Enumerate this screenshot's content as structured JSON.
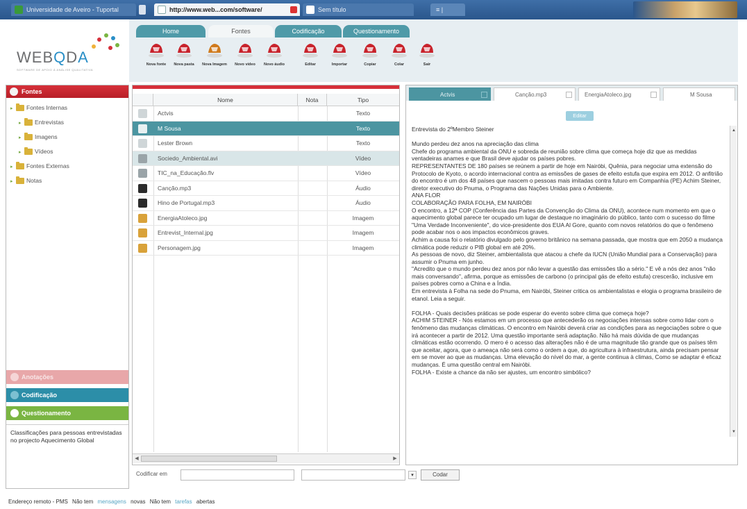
{
  "browser": {
    "tabs": [
      "Universidade de Aveiro - Tuportal",
      "http://www.web...com/software/",
      "Sem título"
    ],
    "extra_tab": "≡ |"
  },
  "logo": {
    "text_prefix": "WEB",
    "text_q": "Q",
    "text_d": "D",
    "text_a": "A",
    "subtitle": "SOFTWARE DE APOIO À ANÁLISE QUALITATIVA"
  },
  "main_tabs": [
    "Home",
    "Fontes",
    "Codificação",
    "Questionamento"
  ],
  "toolbar": [
    {
      "label": "Nova fonte",
      "color": "#c8232c"
    },
    {
      "label": "Nova pasta",
      "color": "#c8232c"
    },
    {
      "label": "Nova Imagem",
      "color": "#d07a1c"
    },
    {
      "label": "Novo vídeo",
      "color": "#c8232c"
    },
    {
      "label": "Novo áudio",
      "color": "#c8232c"
    },
    {
      "label": "Editar",
      "color": "#c8232c"
    },
    {
      "label": "Importar",
      "color": "#c8232c"
    },
    {
      "label": "Copiar",
      "color": "#c8232c"
    },
    {
      "label": "Colar",
      "color": "#c8232c"
    },
    {
      "label": "Sair",
      "color": "#c8232c"
    }
  ],
  "left_panel": {
    "header": "Fontes",
    "tree": [
      {
        "label": "Fontes Internas",
        "level": 0
      },
      {
        "label": "Entrevistas",
        "level": 1
      },
      {
        "label": "Imagens",
        "level": 1
      },
      {
        "label": "Vídeos",
        "level": 1
      },
      {
        "label": "Fontes Externas",
        "level": 0
      },
      {
        "label": "Notas",
        "level": 0
      }
    ],
    "buttons": {
      "anotacoes": "Anotações",
      "codificacao": "Codificação",
      "questionamento": "Questionamento"
    },
    "note": "Classificações para pessoas entrevistadas no projecto Aquecimento Global"
  },
  "table": {
    "headers": {
      "name": "Nome",
      "note": "Nota",
      "type": "Tipo"
    },
    "rows": [
      {
        "name": "Actvis",
        "type": "Texto",
        "icon_color": "#cfd6d8",
        "state": ""
      },
      {
        "name": "M Sousa",
        "type": "Texto",
        "icon_color": "#e8f1f2",
        "state": "sel"
      },
      {
        "name": "Lester Brown",
        "type": "Texto",
        "icon_color": "#cfd6d8",
        "state": ""
      },
      {
        "name": "Sociedo_Ambiental.avi",
        "type": "Vídeo",
        "icon_color": "#9aa4a8",
        "state": "hl"
      },
      {
        "name": "TIC_na_Educação.flv",
        "type": "Vídeo",
        "icon_color": "#9aa4a8",
        "state": ""
      },
      {
        "name": "Canção.mp3",
        "type": "Áudio",
        "icon_color": "#2b2b2b",
        "state": ""
      },
      {
        "name": "Hino de Portugal.mp3",
        "type": "Áudio",
        "icon_color": "#2b2b2b",
        "state": ""
      },
      {
        "name": "EnergiaAtoleco.jpg",
        "type": "Imagem",
        "icon_color": "#d9a23a",
        "state": ""
      },
      {
        "name": "Entrevist_Internal.jpg",
        "type": "Imagem",
        "icon_color": "#d9a23a",
        "state": ""
      },
      {
        "name": "Personagem.jpg",
        "type": "Imagem",
        "icon_color": "#d9a23a",
        "state": ""
      }
    ]
  },
  "right_tabs": [
    "Actvis",
    "Canção.mp3",
    "EnergiaAtoleco.jpg",
    "M Sousa"
  ],
  "edit_label": "Editar",
  "document": [
    "Entrevista do 2ºMembro Steiner",
    "",
    "Mundo perdeu dez anos na apreciação das clima",
    "Chefe do programa ambiental da ONU e sobreda de reunião sobre clima que começa hoje diz que as medidas ventadeiras anames e que Brasil deve ajudar os países pobres.",
    "REPRESENTANTES DE 180 países se reúnem a partir de hoje em Nairóbi, Quênia, para negociar uma extensão do Protocolo de Kyoto, o acordo internacional contra as emissões de gases de efeito estufa que expira em 2012. O anfitrião do encontro é um dos 48 países que nascem o pessoas mais imitadas contra futuro em Companhia (PE) Achim Steiner, diretor executivo do Pnuma, o Programa das Nações Unidas para o Ambiente.",
    "ANA FLOR",
    "COLABORAÇÃO PARA FOLHA, EM NAIRÓBI",
    "O encontro, a 12ª COP (Conferência das Partes da Convenção do Clima da ONU), acontece num momento em que o aquecimento global parece ter ocupado um lugar de destaque no imaginário do público, tanto com o sucesso do filme \"Uma Verdade Inconveniente\", do vice-presidente dos EUA Al Gore, quanto com novos relatórios do que o fenômeno pode acabar nos o aos impactos econômicos graves.",
    "Achim a causa foi o relatório divulgado pelo governo britânico na semana passada, que mostra que em 2050 a mudança climática pode reduzir o PIB global em até 20%.",
    "As pessoas de novo, diz Steiner, ambientalista que atacou a chefe da IUCN (União Mundial para a Conservação) para assumir o Pnuma em junho.",
    "\"Acredito que o mundo perdeu dez anos por não levar a questão das emissões tão a sério.\" E vê a nós dez anos \"não mais conversando\", afirma, porque as emissões de carbono (o principal gás de efeito estufa) crescerão, inclusive em países pobres como a China e a Índia.",
    "Em entrevista à Folha na sede do Pnuma, em Nairóbi, Steiner critica os ambientalistas e elogia o programa brasileiro de etanol. Leia a seguir.",
    "",
    "FOLHA - Quais decisões práticas se pode esperar do evento sobre clima que começa hoje?",
    "ACHIM STEINER - Nós estamos em um processo que antecederão os negociações intensas sobre como lidar com o fenômeno das mudanças climáticas. O encontro em Nairóbi deverá criar as condições para as negociações sobre o que irá acontecer a partir de 2012. Uma questão importante será adaptação. Não há mais dúvida de que mudanças climáticas estão ocorrendo. O mero é o acesso das alterações não é de uma magnitude tão grande que os países têm que aceitar, agora, que o ameaça não será como o ordem a que, do agricultura à infraestrutura, ainda precisam pensar em se mover ao que as mudanças. Uma elevação do nível do mar, a gente continua à climas, Como se adaptar é eficaz mudanças. É uma questão central em Nairóbi.",
    "FOLHA - Existe a chance da não ser ajustes, um encontro simbólico?"
  ],
  "codify": {
    "label": "Codificar em",
    "button": "Codar"
  },
  "status": {
    "parts": [
      "Endereço remoto - PMS",
      "Não tem",
      "mensagens",
      "novas",
      "Não tem",
      "tarefas",
      "abertas"
    ]
  },
  "colors": {
    "accent_red": "#d6303a",
    "teal": "#4c95a1",
    "green": "#7ab542"
  }
}
